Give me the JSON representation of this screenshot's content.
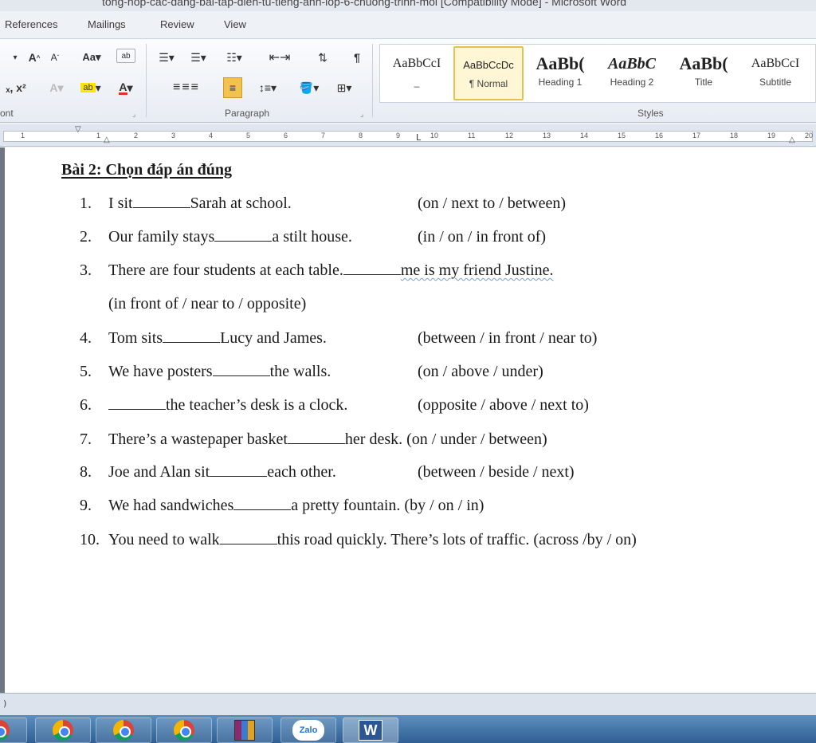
{
  "window": {
    "title": "tong-hop-cac-dang-bai-tap-dien-tu-tieng-anh-lop-6-chuong-trinh-moi [Compatibility Mode] - Microsoft Word"
  },
  "ribbon_tabs": [
    "References",
    "Mailings",
    "Review",
    "View"
  ],
  "ribbon": {
    "font_group_label": "ont",
    "paragraph_group_label": "Paragraph",
    "styles_group_label": "Styles",
    "styles": [
      {
        "preview": "AaBbCcI",
        "name": "_"
      },
      {
        "preview": "AaBbCcDc",
        "name": "¶ Normal"
      },
      {
        "preview": "AaBb(",
        "name": "Heading 1"
      },
      {
        "preview": "AaBbC",
        "name": "Heading 2"
      },
      {
        "preview": "AaBb(",
        "name": "Title"
      },
      {
        "preview": "AaBbCcI",
        "name": "Subtitle"
      }
    ]
  },
  "ruler": {
    "numbers": [
      "1",
      "1",
      "2",
      "3",
      "4",
      "5",
      "6",
      "7",
      "8",
      "9",
      "10",
      "11",
      "12",
      "13",
      "14",
      "15",
      "16",
      "17",
      "18",
      "19",
      "20"
    ]
  },
  "document": {
    "title": "Bài 2: Chọn đáp án đúng",
    "items": [
      {
        "num": "1.",
        "before": "I sit",
        "after": "Sarah at school.",
        "options": "(on / next to / between)"
      },
      {
        "num": "2.",
        "before": "Our family stays",
        "after": "a stilt house.",
        "options": "(in / on / in front of)"
      },
      {
        "num": "3.",
        "before": "There are four students at each table.",
        "after": "me is my friend Justine.",
        "options": "(in front of / near to / opposite)"
      },
      {
        "num": "4.",
        "before": "Tom sits",
        "after": "Lucy and James.",
        "options": "(between / in front / near to)"
      },
      {
        "num": "5.",
        "before": "We have posters",
        "after": "the walls.",
        "options": "(on / above / under)"
      },
      {
        "num": "6.",
        "before": "",
        "after": "the teacher’s desk is a clock.",
        "options": "(opposite / above / next to)"
      },
      {
        "num": "7.",
        "before": "There’s a wastepaper basket",
        "after": "her desk.",
        "options": "(on / under / between)"
      },
      {
        "num": "8.",
        "before": "Joe and Alan sit",
        "after": "each other.",
        "options": "(between / beside / next)"
      },
      {
        "num": "9.",
        "before": "We had sandwiches",
        "after": "a pretty fountain.",
        "options": "(by / on / in)"
      },
      {
        "num": "10.",
        "before": "You need to walk",
        "after": "this road quickly. There’s lots of traffic.",
        "options": "(across /by / on)"
      }
    ]
  },
  "status_bar": {
    "left_text": ")"
  },
  "taskbar": {
    "apps": [
      "chrome-icon",
      "chrome-icon",
      "chrome-icon",
      "winrar-icon",
      "zalo-icon",
      "word-icon"
    ],
    "zalo_label": "Zalo",
    "word_label": "W"
  },
  "colors": {
    "selected_style_border": "#e7c14e",
    "font_color_underline": "#e03030",
    "highlight": "#ffe400",
    "taskbar": "#2f5f93"
  }
}
